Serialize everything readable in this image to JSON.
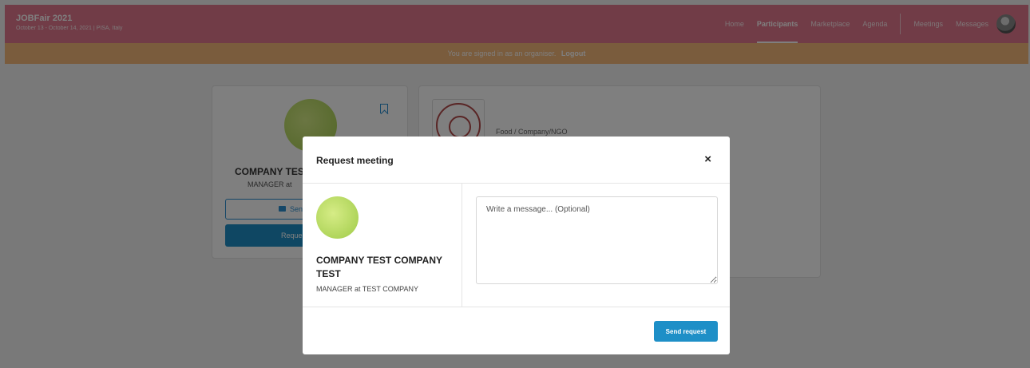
{
  "header": {
    "title": "JOBFair 2021",
    "subtitle": "October 13 - October 14, 2021 | PISA, Italy",
    "nav": [
      {
        "label": "Home"
      },
      {
        "label": "Participants"
      },
      {
        "label": "Marketplace"
      },
      {
        "label": "Agenda"
      },
      {
        "label": "Meetings"
      },
      {
        "label": "Messages"
      }
    ],
    "active_nav": "Participants"
  },
  "organiser_bar": {
    "text": "You are signed in as an organiser.",
    "logout": "Logout"
  },
  "profile_card": {
    "name": "COMPANY TEST",
    "role": "MANAGER at",
    "send_label": "Send",
    "request_label": "Reque"
  },
  "org_card": {
    "category": "Food / Company/NGO"
  },
  "modal": {
    "title": "Request meeting",
    "close": "×",
    "participant_name": "COMPANY TEST COMPANY TEST",
    "participant_role": "MANAGER at TEST COMPANY",
    "message_placeholder": "Write a message... (Optional)",
    "send_button": "Send request"
  },
  "colors": {
    "header": "#e2788e",
    "organiser_bar": "#f5b87a",
    "primary": "#1e8fc7"
  },
  "icons": {
    "close": "close-icon",
    "bookmark": "bookmark-icon",
    "chat": "chat-icon"
  }
}
